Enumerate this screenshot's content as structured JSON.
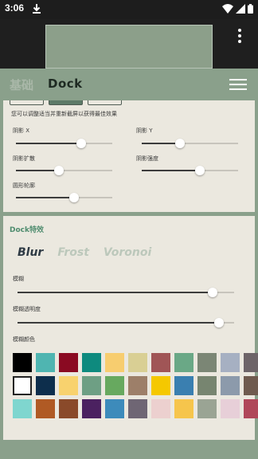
{
  "status": {
    "time": "3:06"
  },
  "header": {
    "tab_basic": "基础",
    "tab_dock": "Dock"
  },
  "card1": {
    "hint": "您可以调整适当并重新截屏以获得最佳效果",
    "sliders": [
      {
        "label": "阴影 X",
        "value": 0.68
      },
      {
        "label": "阴影 Y",
        "value": 0.4
      },
      {
        "label": "阴影扩散",
        "value": 0.45
      },
      {
        "label": "阴影强度",
        "value": 0.6
      },
      {
        "label": "圆形轮廓",
        "value": 0.6
      }
    ]
  },
  "card2": {
    "section_title": "Dock特效",
    "effects": [
      {
        "label": "Blur",
        "active": true
      },
      {
        "label": "Frost",
        "active": false
      },
      {
        "label": "Voronoi",
        "active": false
      }
    ],
    "blur_label": "模糊",
    "blur_value": 0.9,
    "blur_opacity_label": "模糊透明度",
    "blur_opacity_value": 0.93,
    "color_label": "模糊颜色",
    "swatch_rows": [
      [
        "#000000",
        "#4fb5b1",
        "#8a0a22",
        "#0e8a7e",
        "#f7cd6f",
        "#d9cf94",
        "#a05556",
        "#6aa886",
        "#7b8675",
        "#a6b0c2",
        "#6d6468"
      ],
      [
        "#ffffff",
        "#0d2e4c",
        "#f8d26e",
        "#6e9f84",
        "#67a95f",
        "#9d7f69",
        "#f5c800",
        "#3a7fb0",
        "#778570",
        "#8c9aab",
        "#6f5b4f"
      ],
      [
        "#7fd6cf",
        "#b05a24",
        "#8a4a2a",
        "#4b2160",
        "#3d8bbb",
        "#6f6674",
        "#ecd0cf",
        "#f6c54c",
        "#9aa494",
        "#e7cfd8",
        "#b0485a"
      ]
    ],
    "selected_swatch": [
      1,
      0
    ]
  }
}
